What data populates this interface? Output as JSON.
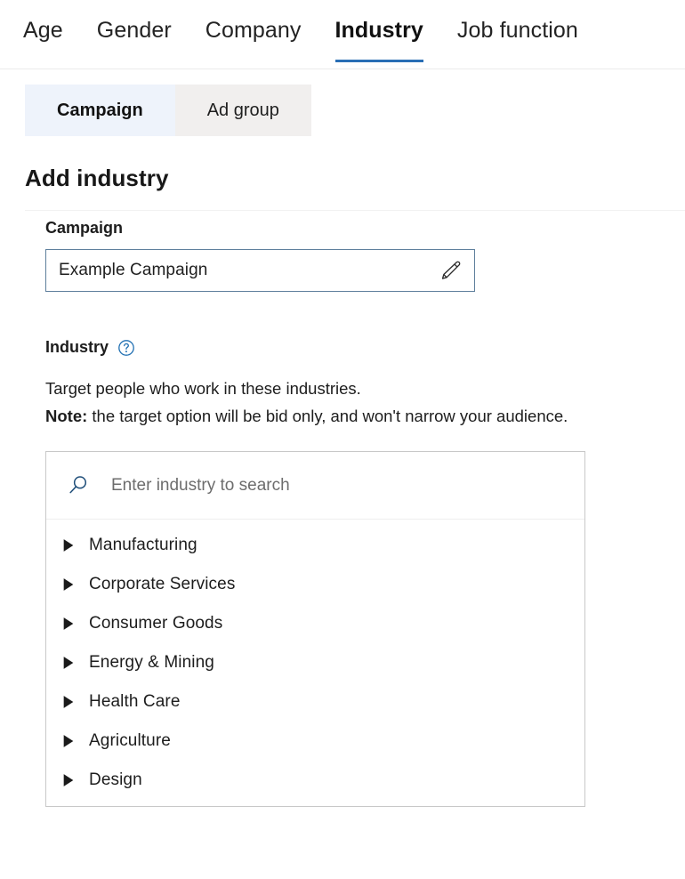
{
  "nav": {
    "tabs": [
      {
        "label": "Age",
        "active": false
      },
      {
        "label": "Gender",
        "active": false
      },
      {
        "label": "Company",
        "active": false
      },
      {
        "label": "Industry",
        "active": true
      },
      {
        "label": "Job function",
        "active": false
      }
    ]
  },
  "segmented": {
    "options": [
      {
        "label": "Campaign",
        "selected": true
      },
      {
        "label": "Ad group",
        "selected": false
      }
    ]
  },
  "main": {
    "title": "Add industry",
    "campaign": {
      "label": "Campaign",
      "value": "Example Campaign",
      "edit_icon": "pencil-icon"
    },
    "industry": {
      "label": "Industry",
      "help_icon": "help-circle-icon",
      "description_line1": "Target people who work in these industries.",
      "note_prefix": "Note:",
      "note_text": " the target option will be bid only, and won't narrow your audience.",
      "search": {
        "placeholder": "Enter industry to search",
        "value": "",
        "icon": "search-icon"
      },
      "items": [
        {
          "label": "Manufacturing"
        },
        {
          "label": "Corporate Services"
        },
        {
          "label": "Consumer Goods"
        },
        {
          "label": "Energy & Mining"
        },
        {
          "label": "Health Care"
        },
        {
          "label": "Agriculture"
        },
        {
          "label": "Design"
        }
      ]
    }
  },
  "colors": {
    "accent_blue": "#2a6fb5",
    "selected_tab_bg": "#eef3fb",
    "unselected_tab_bg": "#f1efee",
    "input_border": "#5e7f9c",
    "panel_border": "#c8c8c8",
    "icon_blue": "#1f4e79"
  }
}
